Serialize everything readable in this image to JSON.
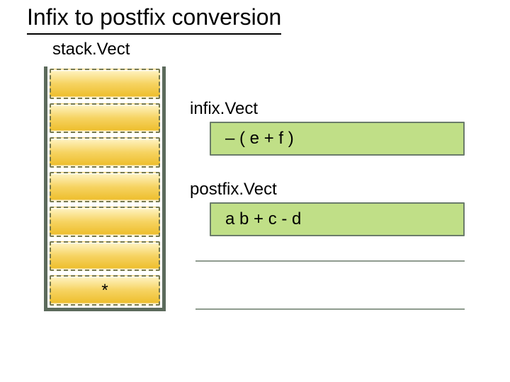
{
  "title": "Infix to postfix conversion",
  "stack": {
    "label": "stack.Vect",
    "cells": [
      "",
      "",
      "",
      "",
      "",
      "",
      "*"
    ]
  },
  "infix": {
    "label": "infix.Vect",
    "value": "– ( e + f )"
  },
  "postfix": {
    "label": "postfix.Vect",
    "value": "a b + c - d"
  }
}
